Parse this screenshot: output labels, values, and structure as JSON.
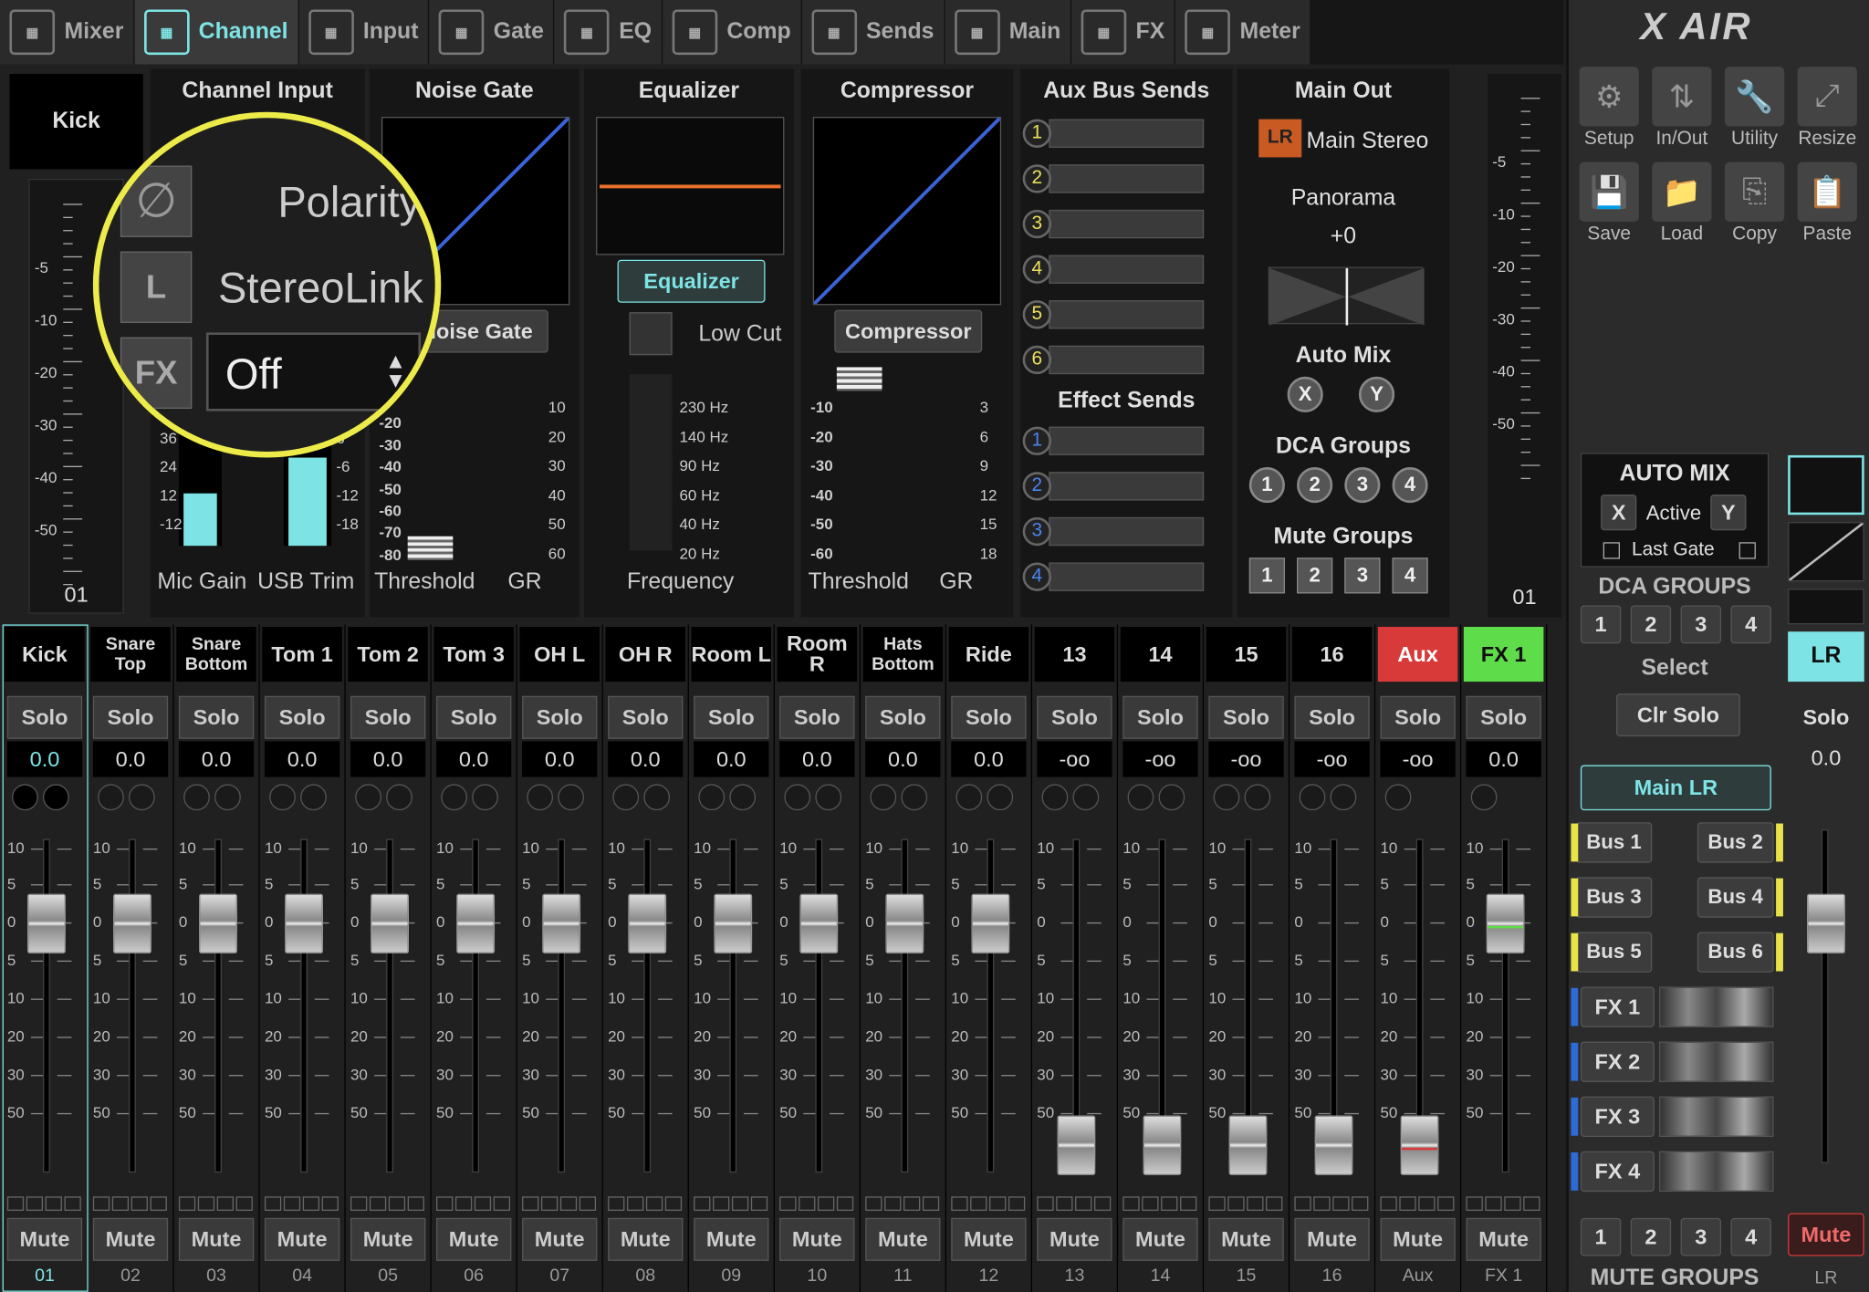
{
  "tabs": [
    {
      "label": "Mixer",
      "icon": "mixer-icon"
    },
    {
      "label": "Channel",
      "icon": "channel-icon"
    },
    {
      "label": "Input",
      "icon": "input-icon"
    },
    {
      "label": "Gate",
      "icon": "gate-icon"
    },
    {
      "label": "EQ",
      "icon": "eq-icon"
    },
    {
      "label": "Comp",
      "icon": "comp-icon"
    },
    {
      "label": "Sends",
      "icon": "sends-icon"
    },
    {
      "label": "Main",
      "icon": "main-icon"
    },
    {
      "label": "FX",
      "icon": "fx-icon"
    },
    {
      "label": "Meter",
      "icon": "meter-icon"
    }
  ],
  "logo": "X AIR",
  "tools": [
    {
      "label": "Setup",
      "icon": "gear-icon"
    },
    {
      "label": "In/Out",
      "icon": "arrows-icon"
    },
    {
      "label": "Utility",
      "icon": "wrench-icon"
    },
    {
      "label": "Resize",
      "icon": "resize-icon"
    },
    {
      "label": "Save",
      "icon": "save-icon"
    },
    {
      "label": "Load",
      "icon": "folder-icon"
    },
    {
      "label": "Copy",
      "icon": "copy-icon"
    },
    {
      "label": "Paste",
      "icon": "paste-icon"
    }
  ],
  "channel": {
    "name": "Kick",
    "number": "01",
    "input_title": "Channel Input",
    "polarity": "Polarity",
    "stereolink": "StereoLink",
    "fx_value": "Off",
    "link_btn": "L",
    "fx_btn": "FX",
    "mic_gain": "Mic Gain",
    "usb_trim": "USB Trim",
    "gain_scale": [
      "36",
      "24",
      "12",
      "-12"
    ],
    "trim_scale": [
      "6",
      "-6",
      "-12",
      "-18"
    ],
    "meter_scale": [
      "-5",
      "-10",
      "-20",
      "-30",
      "-40",
      "-50"
    ]
  },
  "gate": {
    "title": "Noise Gate",
    "button": "Noise Gate",
    "threshold": "Threshold",
    "gr": "GR",
    "thr_scale": [
      "0",
      "-20",
      "-30",
      "-40",
      "-50",
      "-60",
      "-70",
      "-80"
    ],
    "gr_scale": [
      "10",
      "20",
      "30",
      "40",
      "50",
      "60"
    ]
  },
  "eq": {
    "title": "Equalizer",
    "button": "Equalizer",
    "lowcut": "Low Cut",
    "frequency": "Frequency",
    "freqs": [
      "230 Hz",
      "140 Hz",
      "90 Hz",
      "60 Hz",
      "40 Hz",
      "20 Hz"
    ]
  },
  "comp": {
    "title": "Compressor",
    "button": "Compressor",
    "threshold": "Threshold",
    "gr": "GR",
    "thr_scale": [
      "-10",
      "-20",
      "-30",
      "-40",
      "-50",
      "-60"
    ],
    "gr_scale": [
      "3",
      "6",
      "9",
      "12",
      "15",
      "18"
    ]
  },
  "sends": {
    "title": "Aux Bus Sends",
    "aux": [
      "1",
      "2",
      "3",
      "4",
      "5",
      "6"
    ],
    "fx_title": "Effect Sends",
    "fx": [
      "1",
      "2",
      "3",
      "4"
    ]
  },
  "main": {
    "title": "Main Out",
    "lr": "LR",
    "stereo": "Main Stereo",
    "panorama": "Panorama",
    "pan_value": "+0",
    "automix": "Auto Mix",
    "automix_x": "X",
    "automix_y": "Y",
    "dca": "DCA Groups",
    "dca_items": [
      "1",
      "2",
      "3",
      "4"
    ],
    "mute": "Mute Groups",
    "mute_items": [
      "1",
      "2",
      "3",
      "4"
    ]
  },
  "right_meter": {
    "scale": [
      "-5",
      "-10",
      "-20",
      "-30",
      "-40",
      "-50"
    ],
    "number": "01"
  },
  "automix_panel": {
    "title": "AUTO MIX",
    "x": "X",
    "active": "Active",
    "y": "Y",
    "last_gate": "Last Gate"
  },
  "dca_groups": {
    "title": "DCA GROUPS",
    "items": [
      "1",
      "2",
      "3",
      "4"
    ]
  },
  "select": {
    "title": "Select",
    "clr_solo": "Clr Solo",
    "main_lr": "Main LR",
    "buses": [
      "Bus 1",
      "Bus 2",
      "Bus 3",
      "Bus 4",
      "Bus 5",
      "Bus 6"
    ],
    "fx": [
      "FX 1",
      "FX 2",
      "FX 3",
      "FX 4"
    ]
  },
  "mute_groups": {
    "title": "MUTE GROUPS",
    "items": [
      "1",
      "2",
      "3",
      "4"
    ]
  },
  "lr_strip": {
    "name": "LR",
    "solo": "Solo",
    "value": "0.0",
    "mute": "Mute",
    "number": "LR"
  },
  "fader_scale": [
    "10",
    "5",
    "0",
    "5",
    "10",
    "20",
    "30",
    "50"
  ],
  "strips": [
    {
      "name": "Kick",
      "solo": "Solo",
      "value": "0.0",
      "mute": "Mute",
      "num": "01",
      "level": "0.0"
    },
    {
      "name": "Snare Top",
      "solo": "Solo",
      "value": "0.0",
      "mute": "Mute",
      "num": "02",
      "level": "0.0"
    },
    {
      "name": "Snare Bottom",
      "solo": "Solo",
      "value": "0.0",
      "mute": "Mute",
      "num": "03",
      "level": "0.0"
    },
    {
      "name": "Tom 1",
      "solo": "Solo",
      "value": "0.0",
      "mute": "Mute",
      "num": "04",
      "level": "0.0"
    },
    {
      "name": "Tom 2",
      "solo": "Solo",
      "value": "0.0",
      "mute": "Mute",
      "num": "05",
      "level": "0.0"
    },
    {
      "name": "Tom 3",
      "solo": "Solo",
      "value": "0.0",
      "mute": "Mute",
      "num": "06",
      "level": "0.0"
    },
    {
      "name": "OH L",
      "solo": "Solo",
      "value": "0.0",
      "mute": "Mute",
      "num": "07",
      "level": "0.0"
    },
    {
      "name": "OH R",
      "solo": "Solo",
      "value": "0.0",
      "mute": "Mute",
      "num": "08",
      "level": "0.0"
    },
    {
      "name": "Room L",
      "solo": "Solo",
      "value": "0.0",
      "mute": "Mute",
      "num": "09",
      "level": "0.0"
    },
    {
      "name": "Room R",
      "solo": "Solo",
      "value": "0.0",
      "mute": "Mute",
      "num": "10",
      "level": "0.0"
    },
    {
      "name": "Hats Bottom",
      "solo": "Solo",
      "value": "0.0",
      "mute": "Mute",
      "num": "11",
      "level": "0.0"
    },
    {
      "name": "Ride",
      "solo": "Solo",
      "value": "0.0",
      "mute": "Mute",
      "num": "12",
      "level": "0.0"
    },
    {
      "name": "13",
      "solo": "Solo",
      "value": "-oo",
      "mute": "Mute",
      "num": "13",
      "level": "-oo"
    },
    {
      "name": "14",
      "solo": "Solo",
      "value": "-oo",
      "mute": "Mute",
      "num": "14",
      "level": "-oo"
    },
    {
      "name": "15",
      "solo": "Solo",
      "value": "-oo",
      "mute": "Mute",
      "num": "15",
      "level": "-oo"
    },
    {
      "name": "16",
      "solo": "Solo",
      "value": "-oo",
      "mute": "Mute",
      "num": "16",
      "level": "-oo"
    },
    {
      "name": "Aux",
      "solo": "Solo",
      "value": "-oo",
      "mute": "Mute",
      "num": "Aux",
      "level": "-oo"
    },
    {
      "name": "FX 1",
      "solo": "Solo",
      "value": "0.0",
      "mute": "Mute",
      "num": "FX 1",
      "level": "0.0"
    }
  ],
  "colors": {
    "accent": "#7ee3e4",
    "aux_red": "#d83a3a",
    "fx_green": "#5fdc4a",
    "yellow": "#ece05c",
    "blue": "#2d6bd8",
    "orange_lr": "#c85a22"
  }
}
